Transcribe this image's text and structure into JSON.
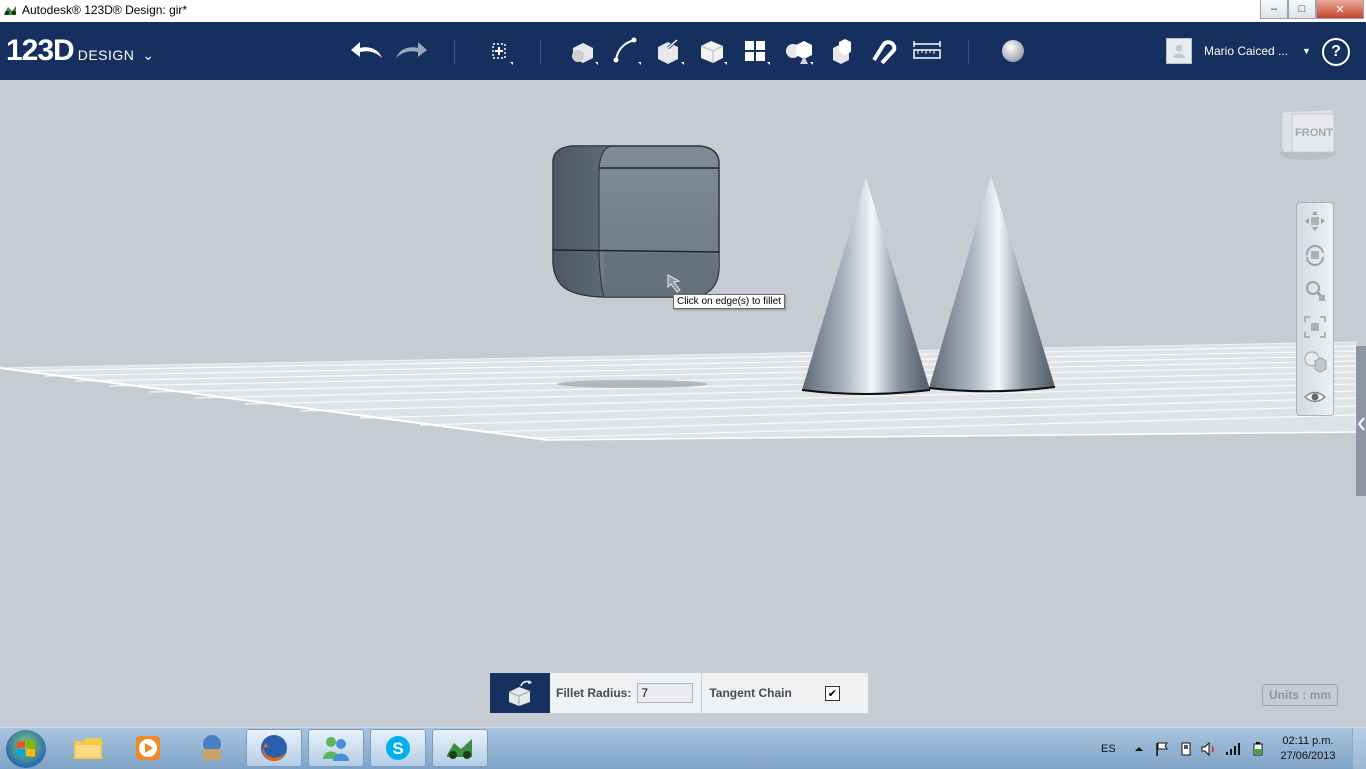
{
  "window": {
    "title": "Autodesk® 123D® Design: gir*",
    "controls": {
      "minimize": "–",
      "maximize": "□",
      "close": "✕"
    }
  },
  "toolbar": {
    "logo_number": "123D",
    "logo_word": "DESIGN",
    "logo_chevron": "⌄",
    "tools": [
      "undo-icon",
      "redo-icon",
      "transform-icon",
      "primitives-icon",
      "sketch-icon",
      "construct-icon",
      "modify-icon",
      "pattern-icon",
      "grouping-icon",
      "combine-icon",
      "snap-icon",
      "measure-icon",
      "material-icon"
    ],
    "user_name": "Mario Caiced ...",
    "user_dropdown": "▼",
    "help": "?"
  },
  "viewport": {
    "tooltip": "Click on edge(s) to fillet",
    "viewcube_label": "FRONT",
    "nav_tools": [
      "pan-icon",
      "orbit-icon",
      "zoom-icon",
      "fit-icon",
      "view-mode-icon",
      "visibility-icon"
    ],
    "units_label": "Units : mm"
  },
  "fillet_panel": {
    "radius_label": "Fillet Radius:",
    "radius_value": "7",
    "tangent_label": "Tangent Chain",
    "tangent_checked": true,
    "check_glyph": "✔"
  },
  "taskbar": {
    "apps": [
      "windows-explorer-icon",
      "media-player-icon",
      "app-icon",
      "firefox-icon",
      "messenger-icon",
      "skype-icon",
      "123d-icon"
    ],
    "language": "ES",
    "time": "02:11 p.m.",
    "date": "27/06/2013"
  },
  "colors": {
    "toolbar": "#152f5e",
    "viewport": "#c7ccd3",
    "fillet_icon_bg": "#173160"
  }
}
